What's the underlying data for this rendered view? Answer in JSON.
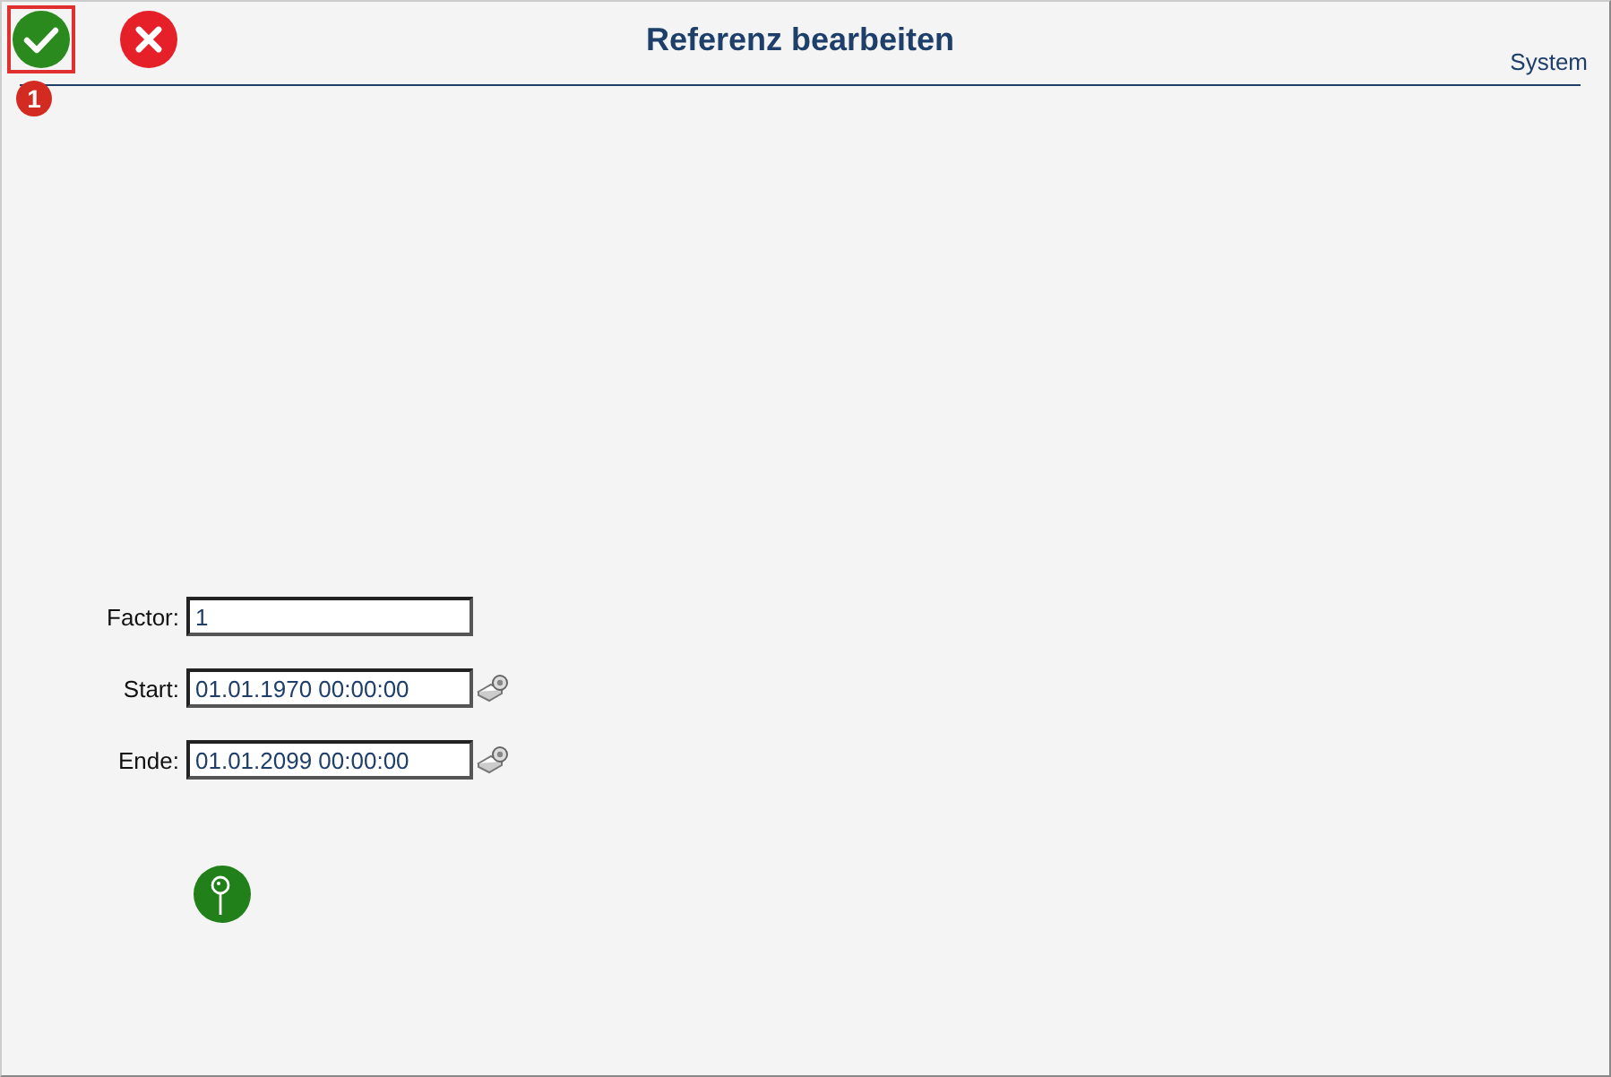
{
  "toolbar": {
    "buttons": [
      {
        "kind": "accept",
        "highlighted": true,
        "badge": "1"
      },
      {
        "kind": "cancel",
        "highlighted": false
      }
    ]
  },
  "title": "Referenz bearbeiten",
  "context": "System",
  "fields": [
    {
      "label": "Factor:",
      "value": "1",
      "kind": "text"
    },
    {
      "label": "Start:",
      "value": "01.01.1970 00:00:00",
      "kind": "datetime"
    },
    {
      "label": "Ende:",
      "value": "01.01.2099 00:00:00",
      "kind": "datetime"
    }
  ],
  "pin_button": {
    "kind": "pin"
  }
}
